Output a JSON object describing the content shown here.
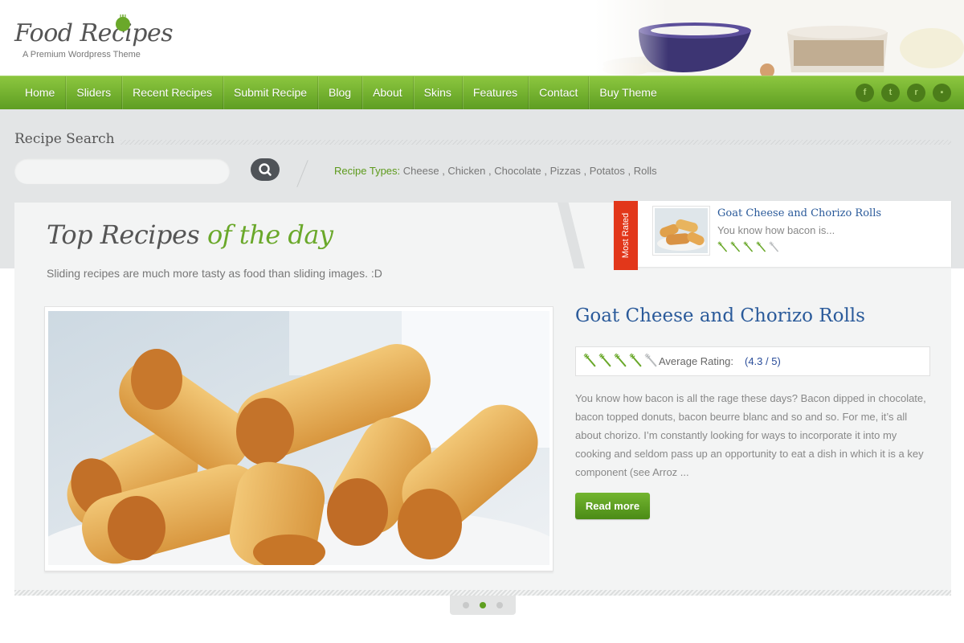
{
  "site": {
    "logo_title": "Food Recipes",
    "logo_subtitle": "A Premium Wordpress Theme"
  },
  "nav": {
    "items": [
      {
        "label": "Home"
      },
      {
        "label": "Sliders"
      },
      {
        "label": "Recent Recipes"
      },
      {
        "label": "Submit Recipe"
      },
      {
        "label": "Blog"
      },
      {
        "label": "About"
      },
      {
        "label": "Skins"
      },
      {
        "label": "Features"
      },
      {
        "label": "Contact"
      },
      {
        "label": "Buy Theme"
      }
    ],
    "social": [
      {
        "icon": "facebook-icon",
        "glyph": "f"
      },
      {
        "icon": "twitter-icon",
        "glyph": "t"
      },
      {
        "icon": "rss-icon",
        "glyph": "r"
      },
      {
        "icon": "flickr-icon",
        "glyph": "▪"
      }
    ]
  },
  "search": {
    "label": "Recipe Search",
    "value": "",
    "types_label": "Recipe Types:",
    "types": [
      "Cheese",
      "Chicken",
      "Chocolate",
      "Pizzas",
      "Potatos",
      "Rolls"
    ]
  },
  "featured": {
    "title_part1": "Top Recipes",
    "title_part2": "of the day",
    "subtitle": "Sliding recipes are much more tasty as food than sliding images. :D"
  },
  "most_rated": {
    "ribbon": "Most Rated",
    "title": "Goat Cheese and Chorizo Rolls",
    "excerpt": "You know how bacon is...",
    "rating": 4.3
  },
  "slide": {
    "title": "Goat Cheese and Chorizo Rolls",
    "rating_label": "Average Rating:",
    "rating_value": "(4.3 / 5)",
    "rating": 4.3,
    "excerpt": "You know how bacon is all the rage these days? Bacon dipped in chocolate, bacon topped donuts, bacon beurre blanc and so and so. For me, it’s all about chorizo. I’m constantly looking for ways to incorporate it into my cooking and seldom pass up an opportunity to eat a dish in which it is a key component (see Arroz ...",
    "read_more": "Read more"
  },
  "pager": {
    "count": 3,
    "active": 2
  },
  "colors": {
    "accent_green": "#6aa82a",
    "link_blue": "#2a5a9a",
    "ribbon_red": "#e2371a"
  }
}
